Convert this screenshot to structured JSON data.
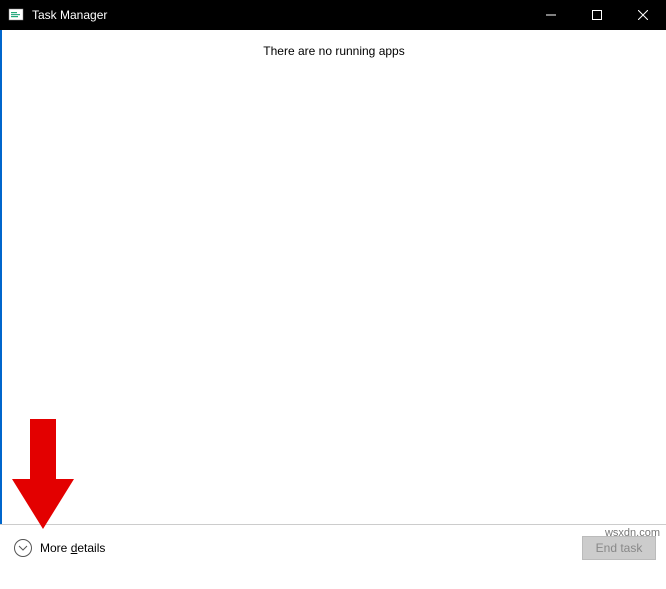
{
  "titlebar": {
    "title": "Task Manager"
  },
  "main": {
    "empty_message": "There are no running apps"
  },
  "footer": {
    "more_details_label": "More details",
    "end_task_label": "End task"
  },
  "watermark": "wsxdn.com"
}
